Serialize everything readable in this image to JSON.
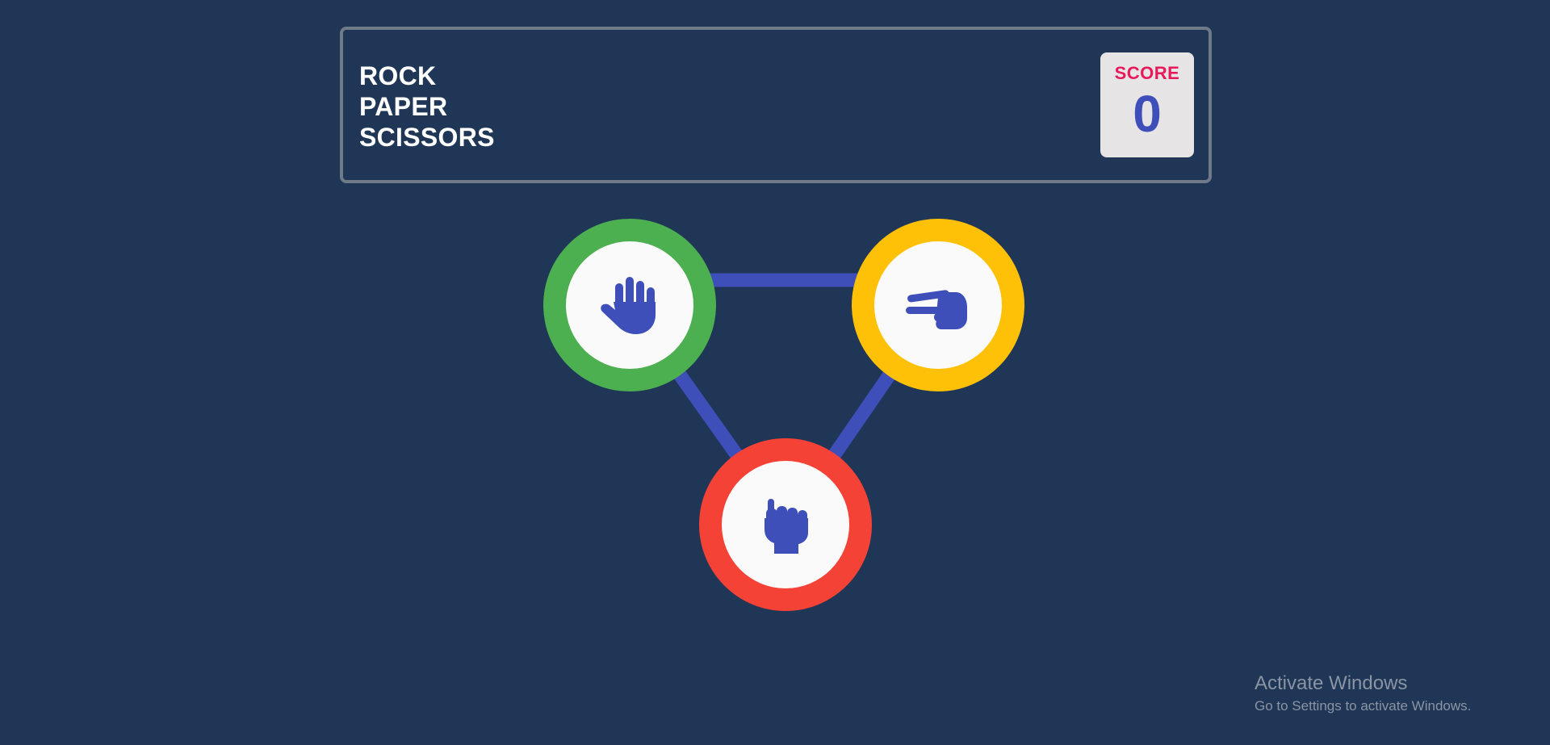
{
  "header": {
    "title_lines": [
      "ROCK",
      "PAPER",
      "SCISSORS"
    ],
    "score_label": "SCORE",
    "score_value": "0"
  },
  "choices": [
    {
      "id": "paper",
      "icon": "hand-paper-icon",
      "ring_color": "#4caf50"
    },
    {
      "id": "scissors",
      "icon": "hand-scissors-icon",
      "ring_color": "#ffc107"
    },
    {
      "id": "rock",
      "icon": "hand-rock-icon",
      "ring_color": "#f44336"
    }
  ],
  "colors": {
    "background": "#1f3656",
    "connector": "#3f4fba",
    "icon": "#3f4fba",
    "score_label": "#e8195a"
  },
  "watermark": {
    "title": "Activate Windows",
    "subtitle": "Go to Settings to activate Windows."
  }
}
